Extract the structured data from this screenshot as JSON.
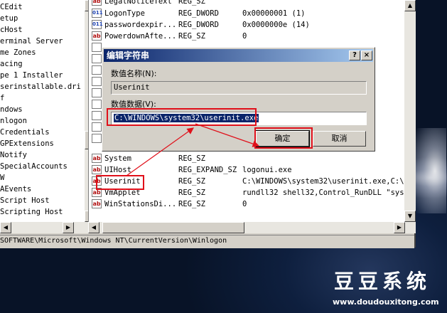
{
  "tree": {
    "items": [
      "CEdit",
      "etup",
      "cHost",
      "erminal Server",
      "me Zones",
      "acing",
      "pe 1 Installer",
      "serinstallable.dri",
      "f",
      "ndows",
      "nlogon",
      "Credentials",
      "GPExtensions",
      "Notify",
      "SpecialAccounts",
      "W",
      "AEvents",
      "Script Host",
      "Scripting Host"
    ]
  },
  "values_list": {
    "rows": [
      {
        "name": "LegalNoticeText",
        "type": "REG_SZ",
        "data": "",
        "icon": "string-value-icon"
      },
      {
        "name": "LogonType",
        "type": "REG_DWORD",
        "data": "0x00000001 (1)",
        "icon": "dword-value-icon"
      },
      {
        "name": "passwordexpir...",
        "type": "REG_DWORD",
        "data": "0x0000000e (14)",
        "icon": "dword-value-icon"
      },
      {
        "name": "PowerdownAfte...",
        "type": "REG_SZ",
        "data": "0",
        "icon": "string-value-icon"
      },
      {
        "name": "System",
        "type": "REG_SZ",
        "data": "",
        "icon": "string-value-icon"
      },
      {
        "name": "UIHost",
        "type": "REG_EXPAND_SZ",
        "data": "logonui.exe",
        "icon": "string-value-icon"
      },
      {
        "name": "Userinit",
        "type": "REG_SZ",
        "data": "C:\\WINDOWS\\system32\\userinit.exe,C:\\Pr",
        "icon": "string-value-icon"
      },
      {
        "name": "VmApplet",
        "type": "REG_SZ",
        "data": "rundll32 shell32,Control_RunDLL \"sysdm",
        "icon": "string-value-icon"
      },
      {
        "name": "WinStationsDi...",
        "type": "REG_SZ",
        "data": "0",
        "icon": "string-value-icon"
      }
    ],
    "icon_glyphs": {
      "string": "ab",
      "binary": "011"
    }
  },
  "statusbar": {
    "path": "SOFTWARE\\Microsoft\\Windows NT\\CurrentVersion\\Winlogon"
  },
  "dialog": {
    "title": "编辑字符串",
    "help_glyph": "?",
    "close_glyph": "×",
    "value_name_label": "数值名称(N):",
    "value_name": "Userinit",
    "value_data_label": "数值数据(V):",
    "value_data": "C:\\WINDOWS\\system32\\userinit.exe",
    "ok_label": "确定",
    "cancel_label": "取消"
  },
  "watermark": {
    "title": "豆豆系统",
    "url": "www.doudouxitong.com"
  },
  "colors": {
    "annotation_red": "#e0101a",
    "titlebar_start": "#0a246a",
    "titlebar_end": "#a6caf0",
    "window_face": "#d4d0c8"
  }
}
